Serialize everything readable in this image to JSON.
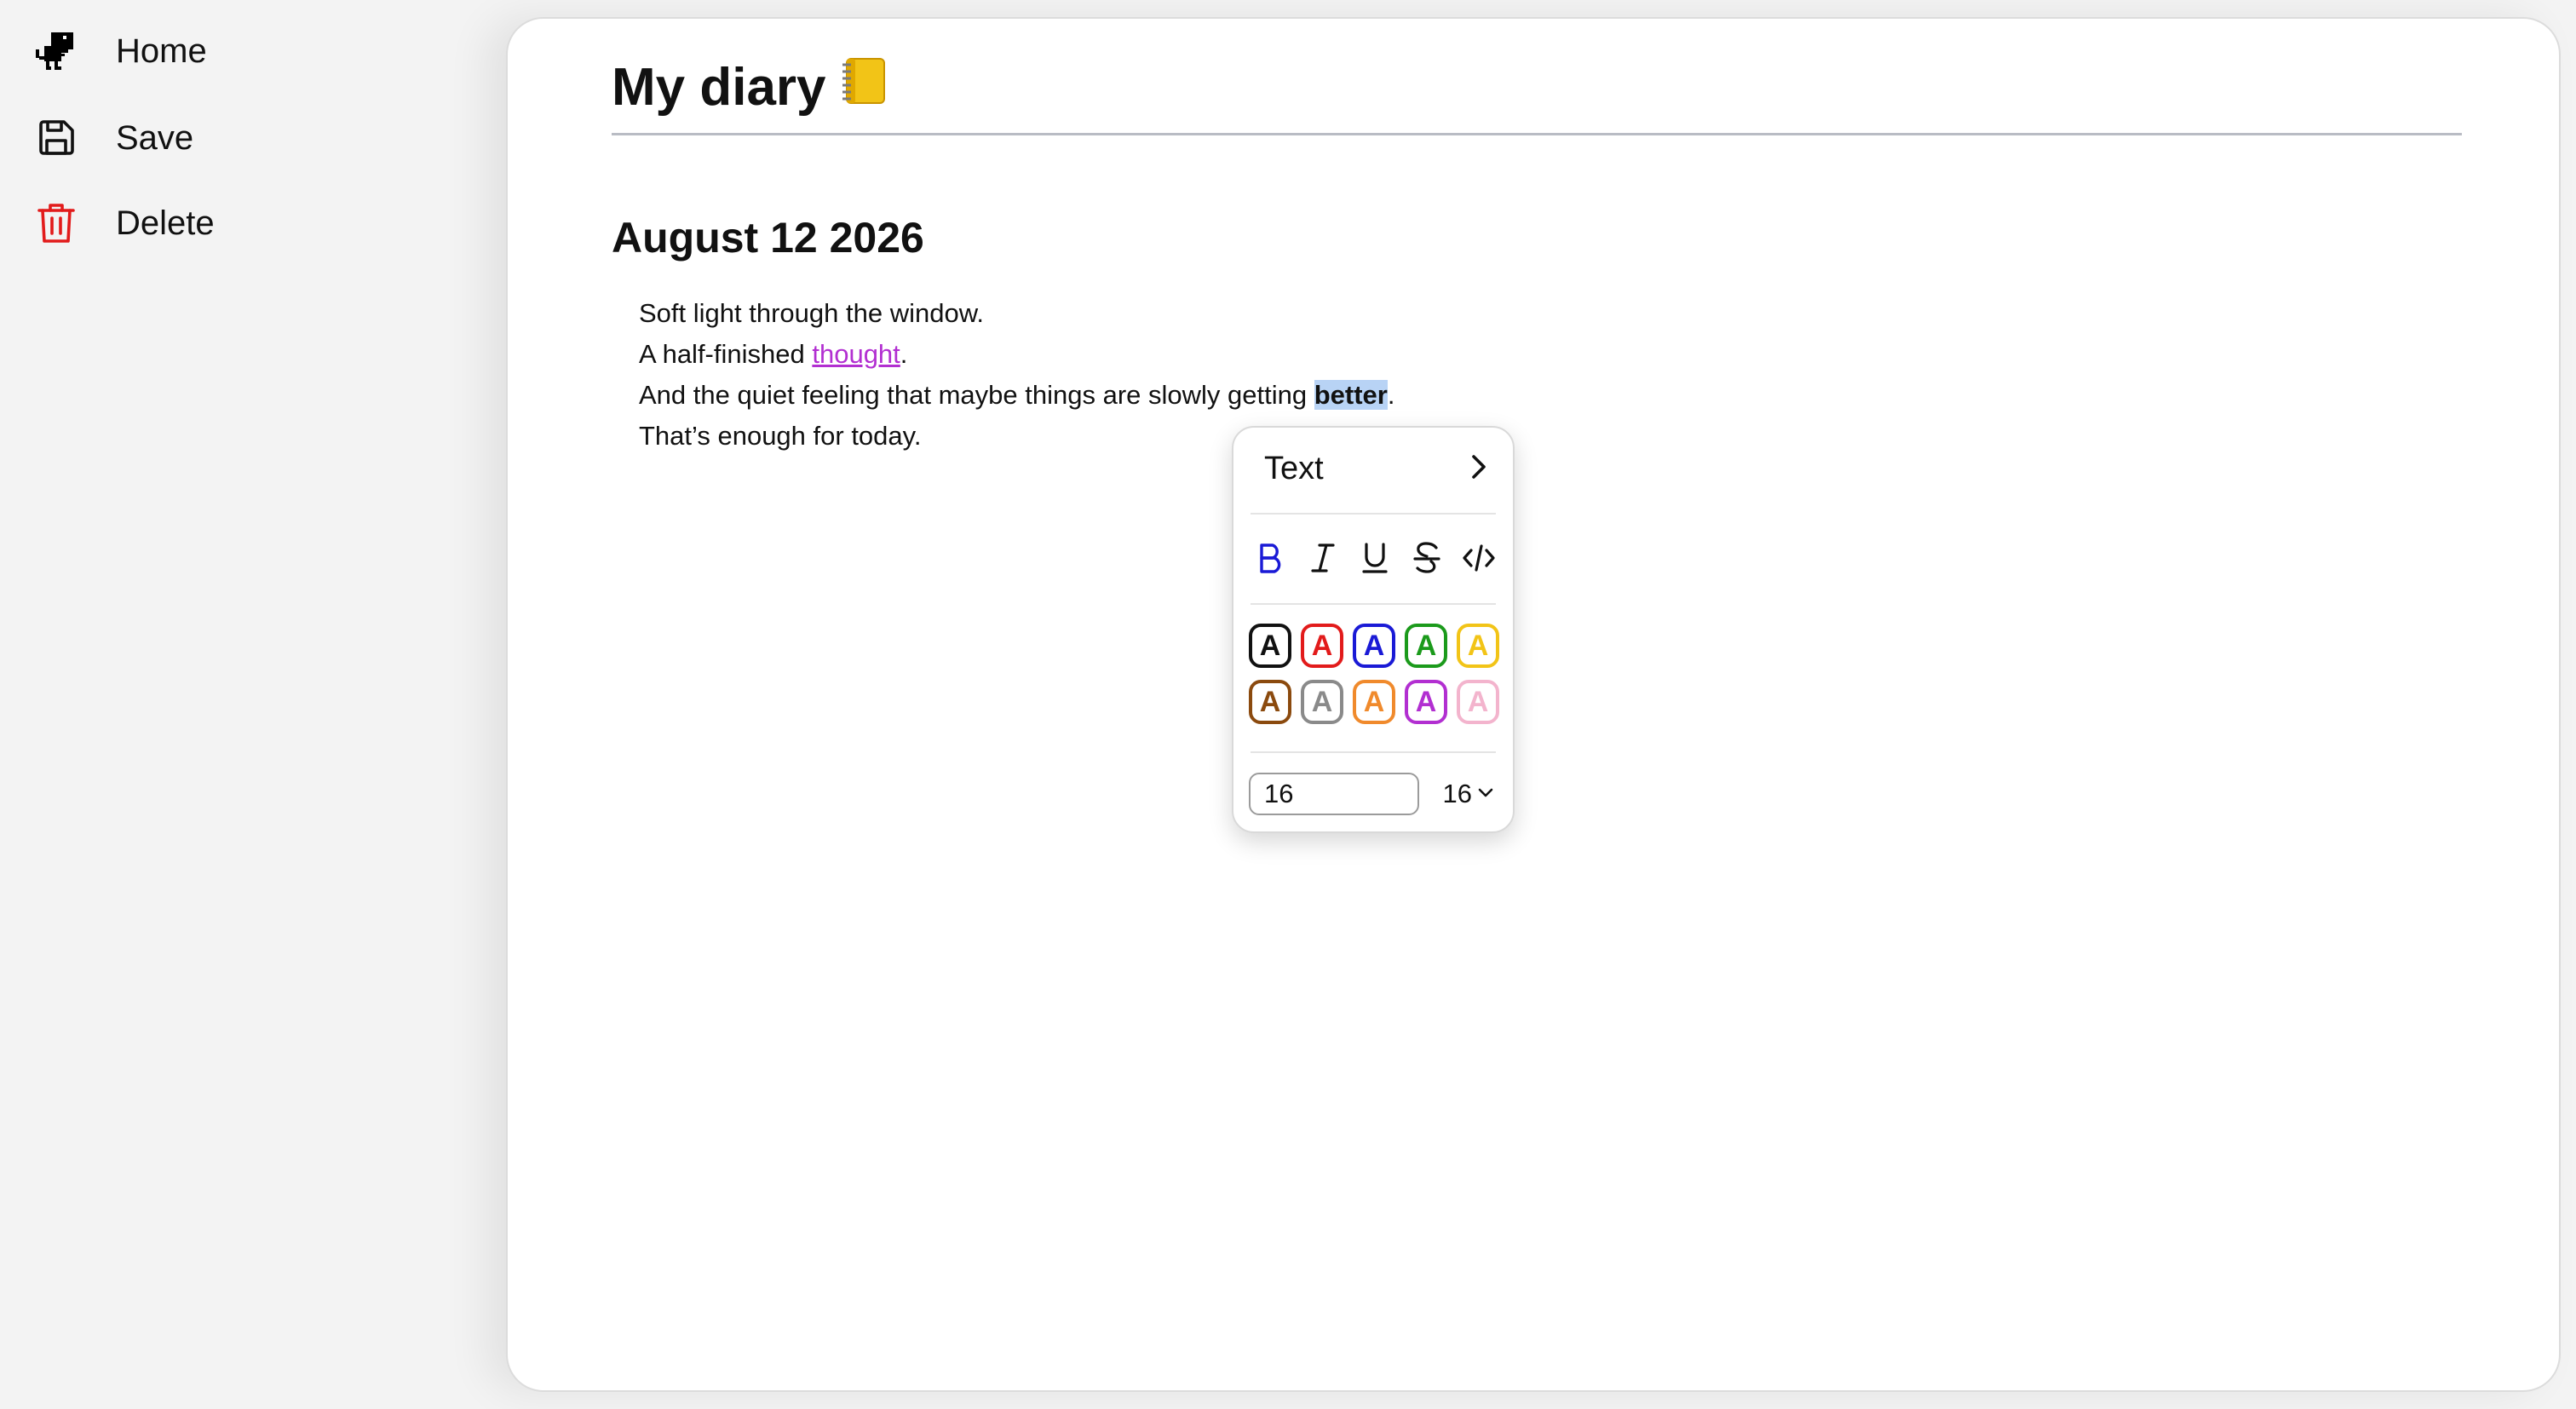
{
  "sidebar": {
    "items": [
      {
        "label": "Home",
        "icon": "dino-logo-icon"
      },
      {
        "label": "Save",
        "icon": "floppy-disk-icon"
      },
      {
        "label": "Delete",
        "icon": "trash-icon",
        "color": "#e21b1b"
      }
    ]
  },
  "document": {
    "title": "My diary",
    "title_emoji": "📒",
    "entry": {
      "date": "August 12 2026",
      "lines": [
        {
          "text": "Soft light through the window."
        },
        {
          "before": "A half-finished ",
          "link": "thought",
          "after": "."
        },
        {
          "before": "And the quiet feeling that maybe things are slowly getting ",
          "selected": "better",
          "after": "."
        },
        {
          "text": "That’s enough for today."
        }
      ]
    }
  },
  "popup": {
    "title": "Text",
    "formatting": [
      {
        "name": "bold",
        "label": "B",
        "active": true
      },
      {
        "name": "italic",
        "label": "I"
      },
      {
        "name": "underline",
        "label": "U"
      },
      {
        "name": "strikethrough",
        "label": "S"
      },
      {
        "name": "code",
        "label": "</>"
      }
    ],
    "swatch_letter": "A",
    "colors": [
      "#111111",
      "#e21b1b",
      "#1a1ad6",
      "#1b9a1b",
      "#f2c417",
      "#8b4a0e",
      "#8a8a8a",
      "#f08a2c",
      "#b22fd1",
      "#f3b4cd"
    ],
    "font_size_value": "16",
    "font_size_selected": "16"
  }
}
